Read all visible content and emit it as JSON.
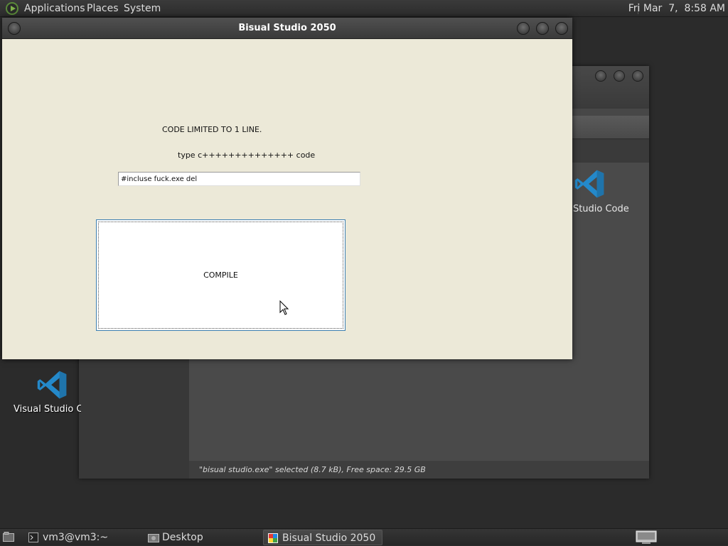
{
  "top_panel": {
    "menus": [
      "Applications",
      "Places",
      "System"
    ],
    "clock": "Fri Mar  7,  8:58 AM"
  },
  "file_manager": {
    "status_text": "\"bisual studio.exe\" selected (8.7 kB), Free space: 29.5 GB",
    "icon_label": "Visual Studio Code"
  },
  "desktop": {
    "icon_label": "Visual Studio Code"
  },
  "app_window": {
    "title": "Bisual Studio 2050",
    "label_limit": "CODE LIMITED TO 1 LINE.",
    "label_type": "type c++++++++++++++ code",
    "code_value": "#incluse fuck.exe del",
    "compile_label": "COMPILE"
  },
  "taskbar": {
    "items": [
      "vm3@vm3:~",
      "Desktop",
      "Bisual Studio 2050"
    ]
  },
  "colors": {
    "window_bg": "#ece9d8",
    "vscode_blue": "#2489ca",
    "panel_bg": "#2c2c2c"
  },
  "icons": {
    "vscode": "vscode-icon",
    "terminal": "terminal-icon",
    "folder": "folder-icon",
    "app": "app-icon"
  }
}
